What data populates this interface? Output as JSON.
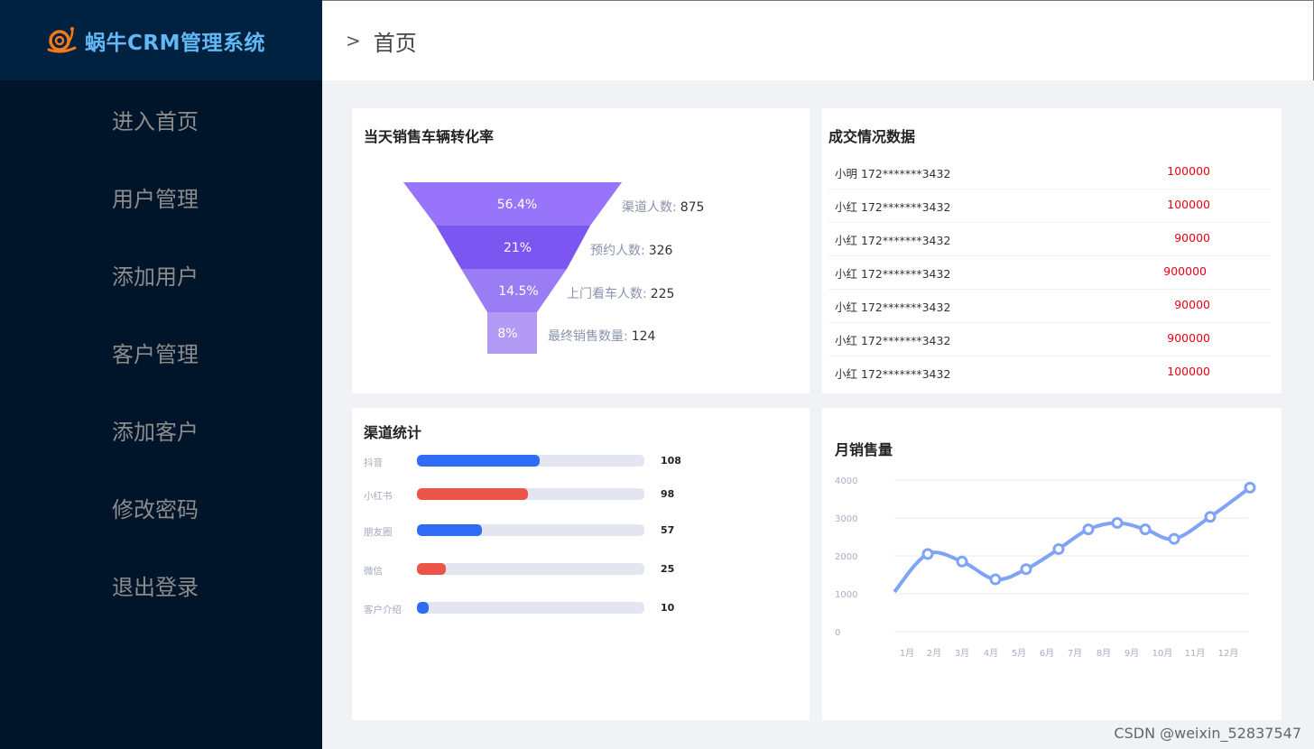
{
  "app": {
    "title": "蜗牛CRM管理系统",
    "logo_icon": "snail-icon"
  },
  "sidebar": {
    "items": [
      {
        "label": "进入首页"
      },
      {
        "label": "用户管理"
      },
      {
        "label": "添加用户"
      },
      {
        "label": "客户管理"
      },
      {
        "label": "添加客户"
      },
      {
        "label": "修改密码"
      },
      {
        "label": "退出登录"
      }
    ]
  },
  "header": {
    "separator": ">",
    "current": "首页"
  },
  "funnel": {
    "title": "当天销售车辆转化率",
    "stages": [
      {
        "percent": "56.4%",
        "label": "渠道人数:",
        "value": "875",
        "color": "#9774fa"
      },
      {
        "percent": "21%",
        "label": "预约人数:",
        "value": "326",
        "color": "#7b56f0"
      },
      {
        "percent": "14.5%",
        "label": "上门看车人数:",
        "value": "225",
        "color": "#9a7cf5"
      },
      {
        "percent": "8%",
        "label": "最终销售数量:",
        "value": "124",
        "color": "#b29af5"
      }
    ]
  },
  "deals": {
    "title": "成交情况数据",
    "rows": [
      {
        "name": "小明 172*******3432",
        "amount": "100000"
      },
      {
        "name": "小红 172*******3432",
        "amount": "100000"
      },
      {
        "name": "小红 172*******3432",
        "amount": "90000"
      },
      {
        "name": "小红 172*******3432",
        "amount": "900000"
      },
      {
        "name": "小红 172*******3432",
        "amount": "90000"
      },
      {
        "name": "小红 172*******3432",
        "amount": "900000"
      },
      {
        "name": "小红 172*******3432",
        "amount": "100000"
      }
    ]
  },
  "channels": {
    "title": "渠道统计",
    "max": 200,
    "rows": [
      {
        "label": "抖音",
        "value": 108,
        "value_text": "108",
        "color": "#2f6cf6"
      },
      {
        "label": "小红书",
        "value": 98,
        "value_text": "98",
        "color": "#eb5446"
      },
      {
        "label": "朋友圈",
        "value": 57,
        "value_text": "57",
        "color": "#2f6cf6"
      },
      {
        "label": "微信",
        "value": 25,
        "value_text": "25",
        "color": "#eb5446"
      },
      {
        "label": "客户介绍",
        "value": 10,
        "value_text": "10",
        "color": "#2f6cf6"
      }
    ]
  },
  "chart_data": {
    "type": "line",
    "title": "月销售量",
    "categories": [
      "1月",
      "2月",
      "3月",
      "4月",
      "5月",
      "6月",
      "7月",
      "8月",
      "9月",
      "10月",
      "11月",
      "12月"
    ],
    "start_value": 1050,
    "series": [
      {
        "values": [
          2050,
          1850,
          1380,
          1650,
          2180,
          2700,
          2870,
          2700,
          2450,
          3030,
          3800
        ],
        "color": "#7ea3f7"
      }
    ],
    "yticks": [
      "0",
      "1000",
      "2000",
      "3000",
      "4000"
    ],
    "ylim": [
      0,
      4000
    ],
    "grid": true,
    "smooth": true
  },
  "watermark": "CSDN @weixin_52837547"
}
